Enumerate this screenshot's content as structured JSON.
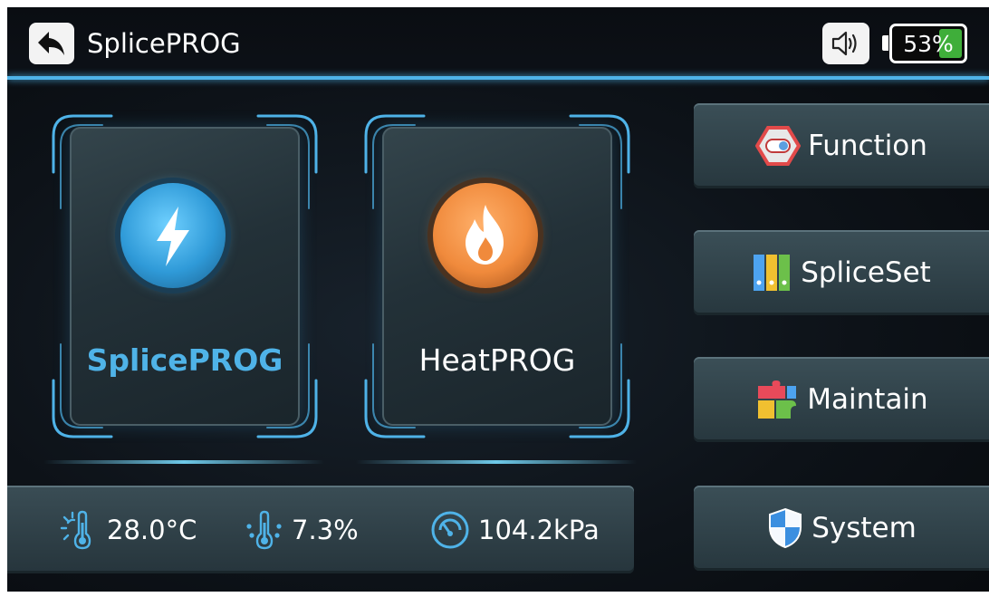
{
  "header": {
    "title": "SplicePROG",
    "battery_percent": "53%",
    "battery_level": 0.53
  },
  "cards": [
    {
      "label": "SplicePROG",
      "icon": "lightning-icon",
      "selected": true,
      "accent": "#4fb3e8"
    },
    {
      "label": "HeatPROG",
      "icon": "flame-icon",
      "selected": false,
      "accent": "#f08a3c"
    }
  ],
  "menu": [
    {
      "label": "Function",
      "icon": "toggle-icon"
    },
    {
      "label": "SpliceSet",
      "icon": "binders-icon"
    },
    {
      "label": "Maintain",
      "icon": "puzzle-icon"
    },
    {
      "label": "System",
      "icon": "shield-icon"
    }
  ],
  "status": {
    "temperature": "28.0°C",
    "humidity": "7.3%",
    "pressure": "104.2kPa"
  },
  "colors": {
    "accent": "#4fb3e8",
    "battery_green": "#3fae3a",
    "heat_orange": "#f08a3c"
  }
}
